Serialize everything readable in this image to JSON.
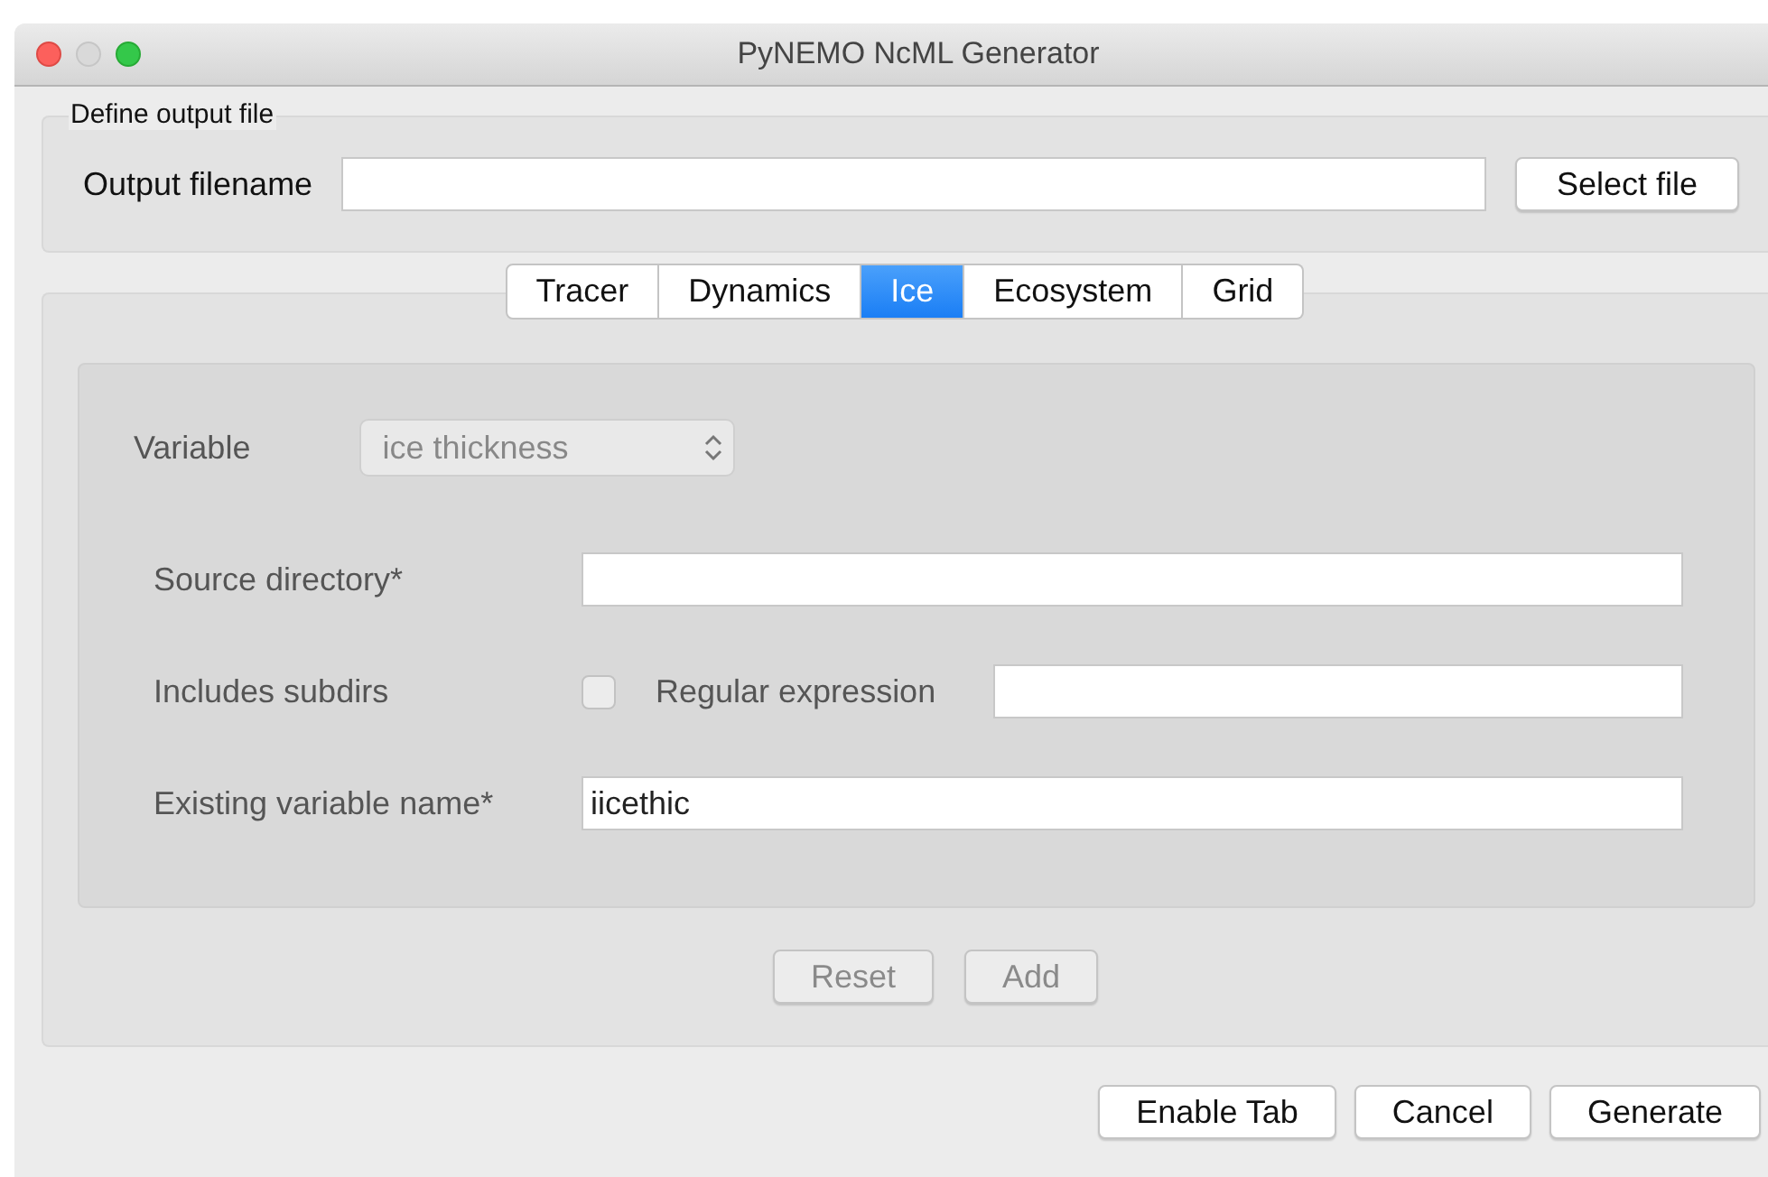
{
  "window": {
    "title": "PyNEMO NcML Generator"
  },
  "output_group": {
    "title": "Define output file",
    "label": "Output filename",
    "button": "Select file"
  },
  "tabs": [
    {
      "label": "Tracer",
      "selected": false
    },
    {
      "label": "Dynamics",
      "selected": false
    },
    {
      "label": "Ice",
      "selected": true
    },
    {
      "label": "Ecosystem",
      "selected": false
    },
    {
      "label": "Grid",
      "selected": false
    }
  ],
  "form": {
    "disabled": true,
    "variable": {
      "label": "Variable",
      "value": "ice thickness"
    },
    "source_directory": {
      "label": "Source directory*"
    },
    "subdirs": {
      "label": "Includes subdirs",
      "checked": false
    },
    "regex": {
      "label": "Regular expression"
    },
    "existing_name": {
      "label": "Existing variable name*",
      "value": "iicethic"
    }
  },
  "form_buttons": [
    {
      "label": "Reset",
      "disabled": true
    },
    {
      "label": "Add",
      "disabled": true
    }
  ],
  "footer_buttons": [
    "Enable Tab",
    "Cancel",
    "Generate"
  ]
}
